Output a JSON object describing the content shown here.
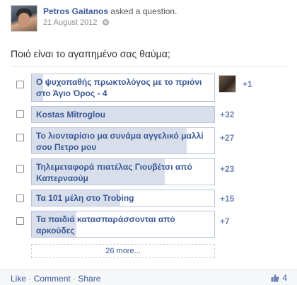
{
  "post": {
    "author": "Petros Gaitanos",
    "action": "asked a question.",
    "date": "21 August 2012",
    "privacy_icon": "globe-icon"
  },
  "question": "Ποιό είναι το αγαπημένο σας θαύμα;",
  "options": [
    {
      "label": "Ο ψυχοπαθής πρωκτολόγος με το πριόνι στο Άγιο Όρος - 4",
      "count": "+1",
      "votes": 2,
      "has_voter_photo": true
    },
    {
      "label": "Kostas Mitroglou",
      "count": "+32",
      "votes": 33,
      "has_voter_photo": false
    },
    {
      "label": "Το λιονταρίσιο μα συνάμα αγγελικό μαλλί σου Πετρο μου",
      "count": "+27",
      "votes": 28,
      "has_voter_photo": false
    },
    {
      "label": "Τηλεμεταφορά πιατέλας Γιουβέτσι από Καπερναούμ",
      "count": "+23",
      "votes": 24,
      "has_voter_photo": false
    },
    {
      "label": "Τα 101 μέλη στο Trobing",
      "count": "+15",
      "votes": 16,
      "has_voter_photo": false
    },
    {
      "label": "Τα παιδιά κατασπαράσσονται από αρκούδες",
      "count": "+7",
      "votes": 8,
      "has_voter_photo": false
    }
  ],
  "more_label": "26 more...",
  "footer": {
    "like": "Like",
    "comment": "Comment",
    "share": "Share",
    "separator": " · ",
    "like_count": "4"
  },
  "colors": {
    "link": "#3b5998",
    "bar_fill": "#d8dfea",
    "bar_border": "#b9c3d8",
    "count": "#6d84b4"
  }
}
